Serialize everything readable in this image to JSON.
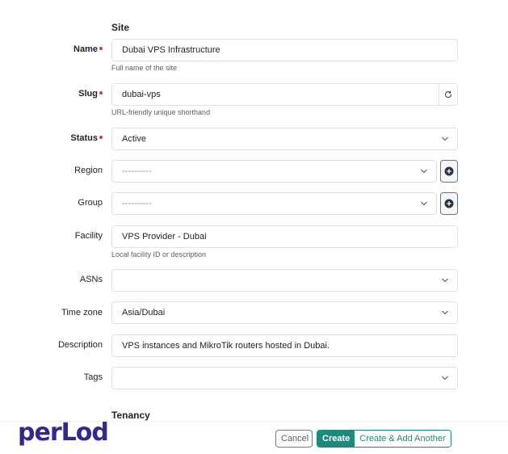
{
  "sections": {
    "site": "Site",
    "tenancy": "Tenancy"
  },
  "fields": {
    "name": {
      "label": "Name",
      "value": "Dubai VPS Infrastructure",
      "help": "Full name of the site",
      "required": true
    },
    "slug": {
      "label": "Slug",
      "value": "dubai-vps",
      "help": "URL-friendly unique shorthand",
      "required": true,
      "button_icon": "refresh-icon"
    },
    "status": {
      "label": "Status",
      "value": "Active",
      "required": true
    },
    "region": {
      "label": "Region",
      "value": "----------",
      "add_icon": "plus-circle-icon"
    },
    "group": {
      "label": "Group",
      "value": "----------",
      "add_icon": "plus-circle-icon"
    },
    "facility": {
      "label": "Facility",
      "value": "VPS Provider - Dubai",
      "help": "Local facility ID or description"
    },
    "asns": {
      "label": "ASNs",
      "value": ""
    },
    "time_zone": {
      "label": "Time zone",
      "value": "Asia/Dubai"
    },
    "description": {
      "label": "Description",
      "value": "VPS instances and MikroTik routers hosted in Dubai."
    },
    "tags": {
      "label": "Tags",
      "value": ""
    }
  },
  "footer": {
    "logo": "perLod",
    "cancel": "Cancel",
    "create": "Create",
    "create_another": "Create & Add Another"
  },
  "colors": {
    "accent": "#1d8a7e",
    "required": "#d63939",
    "logo": "#2f2a8f"
  }
}
